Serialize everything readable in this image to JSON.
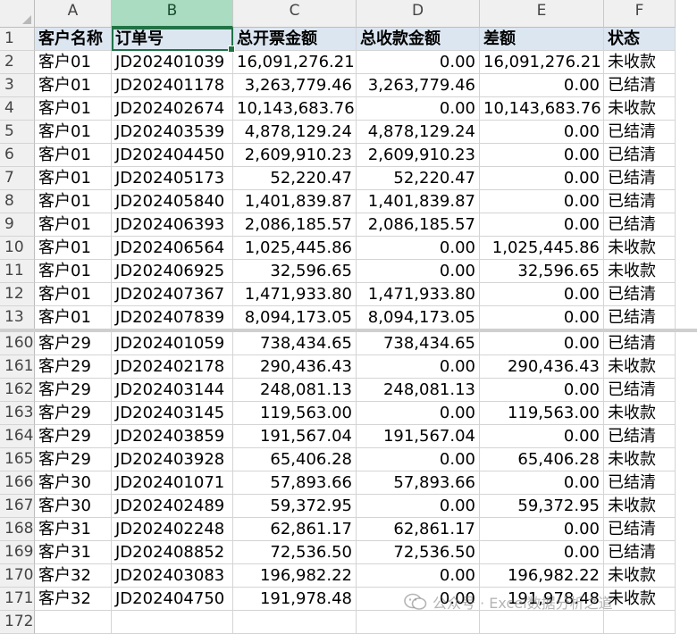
{
  "columns": [
    "A",
    "B",
    "C",
    "D",
    "E",
    "F"
  ],
  "header_row": {
    "num": "1",
    "cells": [
      "客户名称",
      "订单号",
      "总开票金额",
      "总收款金额",
      "差额",
      "状态"
    ]
  },
  "rows_top": [
    {
      "num": "2",
      "c": [
        "客户01",
        "JD202401039",
        "16,091,276.21",
        "0.00",
        "16,091,276.21",
        "未收款"
      ]
    },
    {
      "num": "3",
      "c": [
        "客户01",
        "JD202401178",
        "3,263,779.46",
        "3,263,779.46",
        "0.00",
        "已结清"
      ]
    },
    {
      "num": "4",
      "c": [
        "客户01",
        "JD202402674",
        "10,143,683.76",
        "0.00",
        "10,143,683.76",
        "未收款"
      ]
    },
    {
      "num": "5",
      "c": [
        "客户01",
        "JD202403539",
        "4,878,129.24",
        "4,878,129.24",
        "0.00",
        "已结清"
      ]
    },
    {
      "num": "6",
      "c": [
        "客户01",
        "JD202404450",
        "2,609,910.23",
        "2,609,910.23",
        "0.00",
        "已结清"
      ]
    },
    {
      "num": "7",
      "c": [
        "客户01",
        "JD202405173",
        "52,220.47",
        "52,220.47",
        "0.00",
        "已结清"
      ]
    },
    {
      "num": "8",
      "c": [
        "客户01",
        "JD202405840",
        "1,401,839.87",
        "1,401,839.87",
        "0.00",
        "已结清"
      ]
    },
    {
      "num": "9",
      "c": [
        "客户01",
        "JD202406393",
        "2,086,185.57",
        "2,086,185.57",
        "0.00",
        "已结清"
      ]
    },
    {
      "num": "10",
      "c": [
        "客户01",
        "JD202406564",
        "1,025,445.86",
        "0.00",
        "1,025,445.86",
        "未收款"
      ]
    },
    {
      "num": "11",
      "c": [
        "客户01",
        "JD202406925",
        "32,596.65",
        "0.00",
        "32,596.65",
        "未收款"
      ]
    },
    {
      "num": "12",
      "c": [
        "客户01",
        "JD202407367",
        "1,471,933.80",
        "1,471,933.80",
        "0.00",
        "已结清"
      ]
    },
    {
      "num": "13",
      "c": [
        "客户01",
        "JD202407839",
        "8,094,173.05",
        "8,094,173.05",
        "0.00",
        "已结清"
      ]
    }
  ],
  "rows_bottom": [
    {
      "num": "160",
      "c": [
        "客户29",
        "JD202401059",
        "738,434.65",
        "738,434.65",
        "0.00",
        "已结清"
      ]
    },
    {
      "num": "161",
      "c": [
        "客户29",
        "JD202402178",
        "290,436.43",
        "0.00",
        "290,436.43",
        "未收款"
      ]
    },
    {
      "num": "162",
      "c": [
        "客户29",
        "JD202403144",
        "248,081.13",
        "248,081.13",
        "0.00",
        "已结清"
      ]
    },
    {
      "num": "163",
      "c": [
        "客户29",
        "JD202403145",
        "119,563.00",
        "0.00",
        "119,563.00",
        "未收款"
      ]
    },
    {
      "num": "164",
      "c": [
        "客户29",
        "JD202403859",
        "191,567.04",
        "191,567.04",
        "0.00",
        "已结清"
      ]
    },
    {
      "num": "165",
      "c": [
        "客户29",
        "JD202403928",
        "65,406.28",
        "0.00",
        "65,406.28",
        "未收款"
      ]
    },
    {
      "num": "166",
      "c": [
        "客户30",
        "JD202401071",
        "57,893.66",
        "57,893.66",
        "0.00",
        "已结清"
      ]
    },
    {
      "num": "167",
      "c": [
        "客户30",
        "JD202402489",
        "59,372.95",
        "0.00",
        "59,372.95",
        "未收款"
      ]
    },
    {
      "num": "168",
      "c": [
        "客户31",
        "JD202402248",
        "62,861.17",
        "62,861.17",
        "0.00",
        "已结清"
      ]
    },
    {
      "num": "169",
      "c": [
        "客户31",
        "JD202408852",
        "72,536.50",
        "72,536.50",
        "0.00",
        "已结清"
      ]
    },
    {
      "num": "170",
      "c": [
        "客户32",
        "JD202403083",
        "196,982.22",
        "0.00",
        "196,982.22",
        "未收款"
      ]
    },
    {
      "num": "171",
      "c": [
        "客户32",
        "JD202404750",
        "191,978.48",
        "0.00",
        "191,978.48",
        "未收款"
      ]
    },
    {
      "num": "172",
      "c": [
        "",
        "",
        "",
        "",
        "",
        ""
      ]
    }
  ],
  "selected_column": "B",
  "watermark": {
    "text": "公众号 · Excel数据分析之道"
  }
}
